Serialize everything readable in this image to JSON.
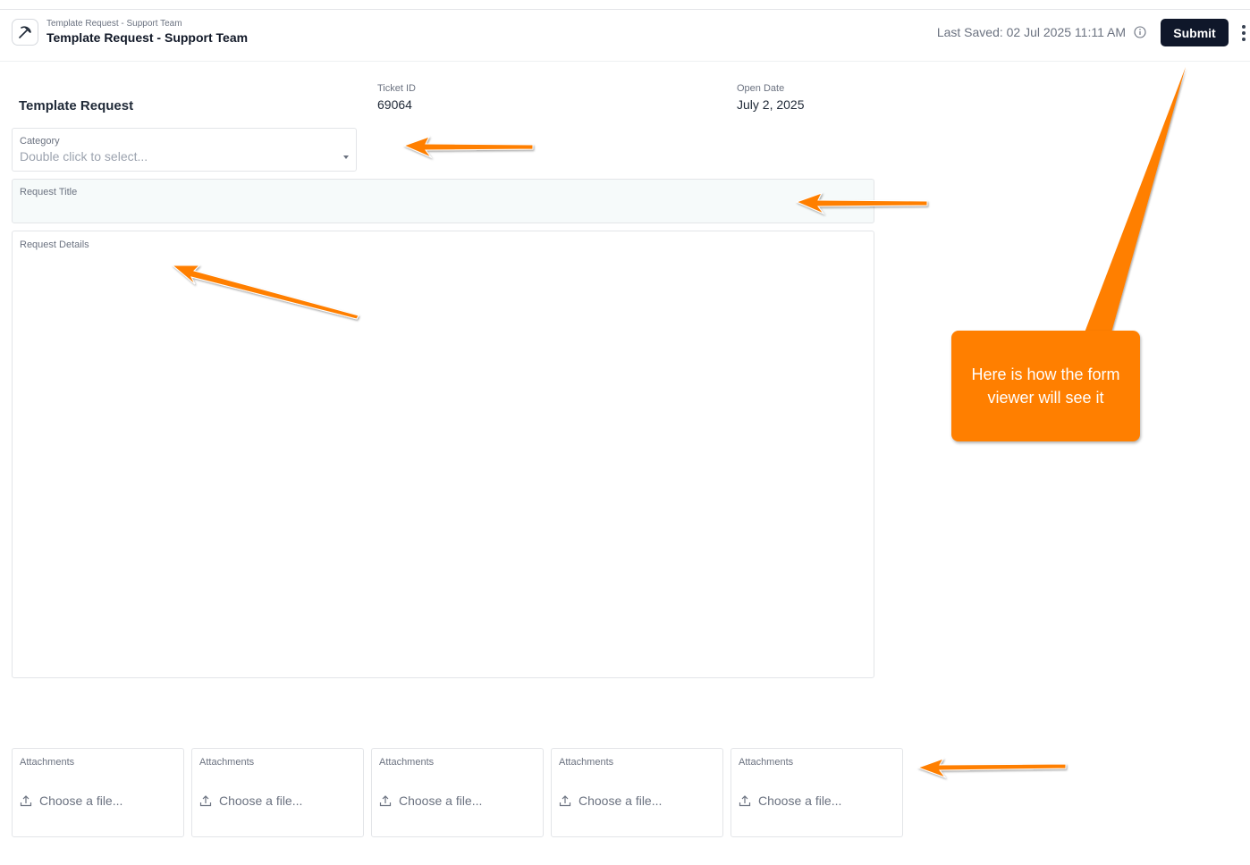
{
  "header": {
    "breadcrumb": "Template Request - Support Team",
    "title": "Template Request - Support Team",
    "last_saved": "Last Saved: 02 Jul 2025 11:11 AM",
    "submit_label": "Submit"
  },
  "form": {
    "section_title": "Template Request",
    "ticket_id_label": "Ticket ID",
    "ticket_id_value": "69064",
    "open_date_label": "Open Date",
    "open_date_value": "July 2, 2025",
    "category": {
      "label": "Category",
      "placeholder": "Double click to select..."
    },
    "request_title": {
      "label": "Request Title",
      "value": ""
    },
    "request_details": {
      "label": "Request Details",
      "value": ""
    },
    "attachments": [
      {
        "label": "Attachments",
        "choose": "Choose a file..."
      },
      {
        "label": "Attachments",
        "choose": "Choose a file..."
      },
      {
        "label": "Attachments",
        "choose": "Choose a file..."
      },
      {
        "label": "Attachments",
        "choose": "Choose a file..."
      },
      {
        "label": "Attachments",
        "choose": "Choose a file..."
      }
    ]
  },
  "annotation": {
    "callout_text": "Here is how the form viewer will see it",
    "color": "#ff7f00"
  },
  "colors": {
    "submit_bg": "#0f172a",
    "title_field_bg": "#f6fafa"
  }
}
